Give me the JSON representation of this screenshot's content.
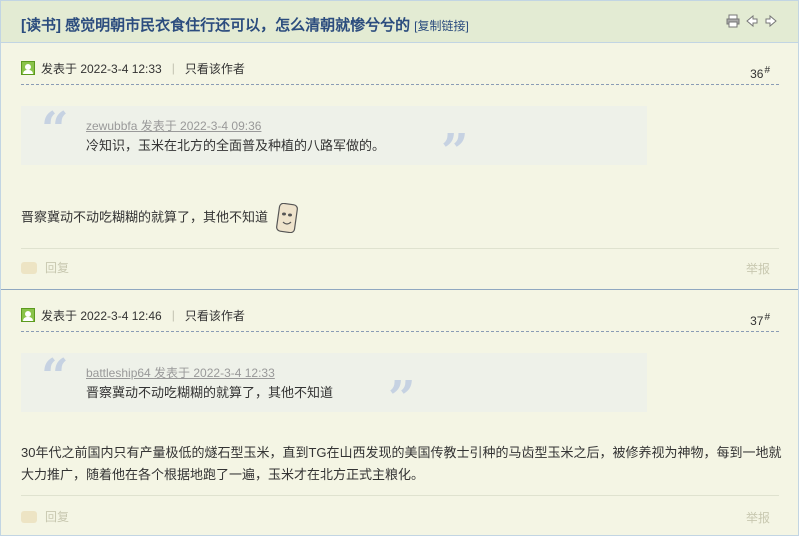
{
  "thread": {
    "title": "[读书] 感觉明朝市民衣食住行还可以，怎么清朝就惨兮兮的",
    "copy_link": "[复制链接]"
  },
  "header_icons": [
    "print-icon",
    "prev-thread-icon",
    "next-thread-icon"
  ],
  "posts": [
    {
      "posted": "发表于 2022-3-4 12:33",
      "only_author": "只看该作者",
      "floor": "36",
      "floor_suffix": "#",
      "quote": {
        "author_line": "zewubbfa 发表于 2022-3-4 09:36",
        "text": "冷知识，玉米在北方的全面普及种植的八路军做的。"
      },
      "body": "晋察冀动不动吃糊糊的就算了，其他不知道",
      "reply": "回复",
      "report": "举报"
    },
    {
      "posted": "发表于 2022-3-4 12:46",
      "only_author": "只看该作者",
      "floor": "37",
      "floor_suffix": "#",
      "quote": {
        "author_line": "battleship64 发表于 2022-3-4 12:33",
        "text": "晋察冀动不动吃糊糊的就算了，其他不知道"
      },
      "body": "30年代之前国内只有产量极低的燧石型玉米，直到TG在山西发现的美国传教士引种的马齿型玉米之后，被修养视为神物，每到一地就大力推广，随着他在各个根据地跑了一遍，玉米才在北方正式主粮化。",
      "reply": "回复",
      "report": "举报"
    }
  ]
}
